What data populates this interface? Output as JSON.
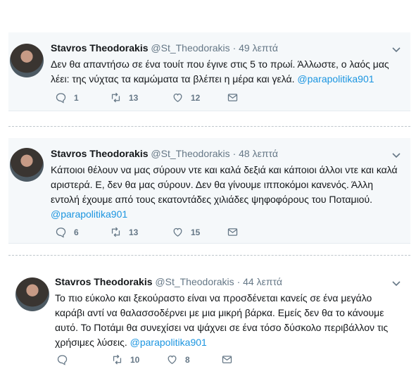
{
  "tweets": [
    {
      "name": "Stavros Theodorakis",
      "handle": "@St_Theodorakis",
      "sep": "·",
      "time": "49 λεπτά",
      "text": "Δεν θα απαντήσω σε ένα τουίτ που έγινε στις 5 το πρωί. Άλλωστε, ο λαός μας λέει: της νύχτας τα καμώματα τα βλέπει η μέρα και γελά.",
      "link": "@parapolitika901",
      "replies": "1",
      "retweets": "13",
      "likes": "12"
    },
    {
      "name": "Stavros Theodorakis",
      "handle": "@St_Theodorakis",
      "sep": "·",
      "time": "48 λεπτά",
      "text": "Κάποιοι θέλουν να μας σύρουν ντε και καλά δεξιά και κάποιοι άλλοι ντε και καλά αριστερά. Ε, δεν θα μας σύρουν. Δεν θα γίνουμε ιπποκόμοι κανενός. Άλλη εντολή έχουμε από τους εκατοντάδες χιλιάδες ψηφοφόρους του Ποταμιού.",
      "link": "@parapolitika901",
      "replies": "6",
      "retweets": "13",
      "likes": "15"
    },
    {
      "name": "Stavros Theodorakis",
      "handle": "@St_Theodorakis",
      "sep": "·",
      "time": "44 λεπτά",
      "text": "Το πιο εύκολο και ξεκούραστο είναι να προσδένεται κανείς σε ένα μεγάλο καράβι αντί να θαλασσοδέρνει με μια μικρή βάρκα. Εμείς δεν θα το κάνουμε αυτό. Το Ποτάμι θα συνεχίσει να ψάχνει σε ένα τόσο δύσκολο περιβάλλον τις χρήσιμες λύσεις.",
      "link": "@parapolitika901",
      "replies": "",
      "retweets": "10",
      "likes": "8"
    }
  ]
}
